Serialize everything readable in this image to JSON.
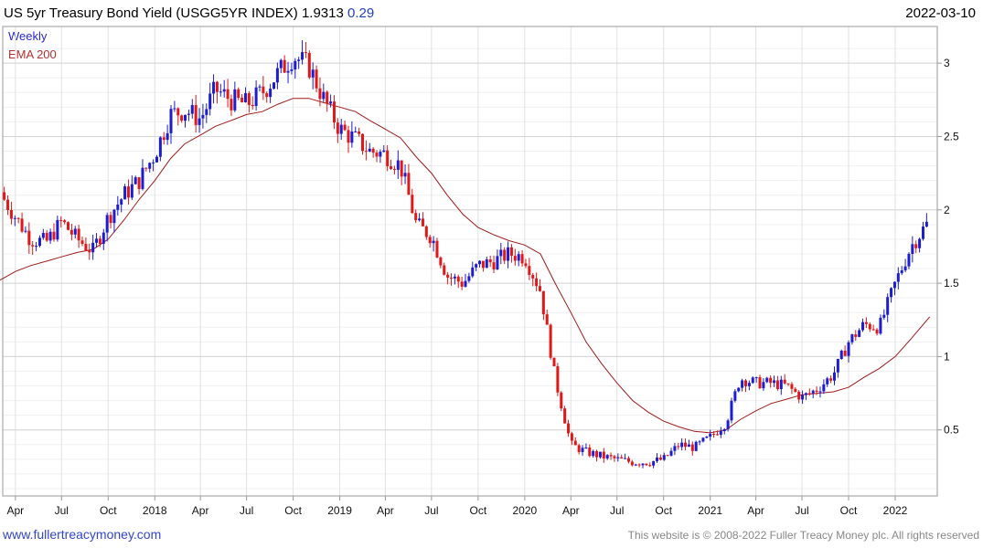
{
  "header": {
    "title": "US 5yr Treasury Bond Yield (USGG5YR INDEX) 1.9313",
    "change": "0.29",
    "date": "2022-03-10"
  },
  "legend": {
    "weekly": "Weekly",
    "ema": "EMA 200"
  },
  "footer": {
    "site": "www.fullertreacymoney.com",
    "copyright": "This website is © 2008-2022 Fuller Treacy Money plc. All rights reserved"
  },
  "colors": {
    "up": "#1c1cd0",
    "down": "#e01818",
    "ema": "#a01a1a",
    "grid": "#e2e2e2",
    "frame": "#999999"
  },
  "chart_data": {
    "type": "line",
    "title": "US 5yr Treasury Bond Yield (USGG5YR INDEX) 1.9313",
    "ylim": [
      0.05,
      3.25
    ],
    "y_ticks": [
      0.5,
      1,
      1.5,
      2,
      2.5,
      3
    ],
    "x_ticks": [
      {
        "label": "Apr",
        "x": "2017-04-01"
      },
      {
        "label": "Jul",
        "x": "2017-07-01"
      },
      {
        "label": "Oct",
        "x": "2017-10-01"
      },
      {
        "label": "2018",
        "x": "2018-01-01"
      },
      {
        "label": "Apr",
        "x": "2018-04-01"
      },
      {
        "label": "Jul",
        "x": "2018-07-01"
      },
      {
        "label": "Oct",
        "x": "2018-10-01"
      },
      {
        "label": "2019",
        "x": "2019-01-01"
      },
      {
        "label": "Apr",
        "x": "2019-04-01"
      },
      {
        "label": "Jul",
        "x": "2019-07-01"
      },
      {
        "label": "Oct",
        "x": "2019-10-01"
      },
      {
        "label": "2020",
        "x": "2020-01-01"
      },
      {
        "label": "Apr",
        "x": "2020-04-01"
      },
      {
        "label": "Jul",
        "x": "2020-07-01"
      },
      {
        "label": "Oct",
        "x": "2020-10-01"
      },
      {
        "label": "2021",
        "x": "2021-01-01"
      },
      {
        "label": "Apr",
        "x": "2021-04-01"
      },
      {
        "label": "Jul",
        "x": "2021-07-01"
      },
      {
        "label": "Oct",
        "x": "2021-10-01"
      },
      {
        "label": "2022",
        "x": "2022-01-01"
      }
    ],
    "series": [
      {
        "type": "line",
        "x": [
          "2017-03-01",
          "2017-04-01",
          "2017-05-01",
          "2017-06-01",
          "2017-07-01",
          "2017-08-01",
          "2017-09-01",
          "2017-10-01",
          "2017-11-01",
          "2017-12-01",
          "2018-01-01",
          "2018-02-01",
          "2018-03-01",
          "2018-04-01",
          "2018-05-01",
          "2018-06-01",
          "2018-07-01",
          "2018-08-01",
          "2018-09-01",
          "2018-10-01",
          "2018-11-01",
          "2018-12-01",
          "2019-01-01",
          "2019-02-01",
          "2019-03-01",
          "2019-04-01",
          "2019-05-01",
          "2019-06-01",
          "2019-07-01",
          "2019-08-01",
          "2019-09-01",
          "2019-10-01",
          "2019-11-01",
          "2019-12-01",
          "2020-01-01",
          "2020-02-01",
          "2020-03-01",
          "2020-04-01",
          "2020-05-01",
          "2020-06-01",
          "2020-07-01",
          "2020-08-01",
          "2020-09-01",
          "2020-10-01",
          "2020-11-01",
          "2020-12-01",
          "2021-01-01",
          "2021-02-01",
          "2021-03-01",
          "2021-04-01",
          "2021-05-01",
          "2021-06-01",
          "2021-07-01",
          "2021-08-01",
          "2021-09-01",
          "2021-10-01",
          "2021-11-01",
          "2021-12-01",
          "2022-01-01",
          "2022-02-01",
          "2022-03-10"
        ],
        "values": [
          1.52,
          1.58,
          1.62,
          1.65,
          1.68,
          1.71,
          1.73,
          1.8,
          1.93,
          2.07,
          2.2,
          2.35,
          2.45,
          2.51,
          2.57,
          2.61,
          2.65,
          2.67,
          2.72,
          2.76,
          2.76,
          2.73,
          2.7,
          2.67,
          2.61,
          2.55,
          2.49,
          2.36,
          2.25,
          2.1,
          1.97,
          1.88,
          1.83,
          1.79,
          1.76,
          1.7,
          1.5,
          1.3,
          1.1,
          0.95,
          0.82,
          0.7,
          0.62,
          0.56,
          0.52,
          0.49,
          0.48,
          0.5,
          0.57,
          0.63,
          0.68,
          0.71,
          0.74,
          0.75,
          0.76,
          0.79,
          0.86,
          0.92,
          1.0,
          1.12,
          1.27
        ]
      },
      {
        "type": "candlestick",
        "x": [
          "2017-03-01",
          "2017-04-01",
          "2017-05-01",
          "2017-06-01",
          "2017-07-01",
          "2017-08-01",
          "2017-09-01",
          "2017-10-01",
          "2017-11-01",
          "2017-12-01",
          "2018-01-01",
          "2018-02-01",
          "2018-03-01",
          "2018-04-01",
          "2018-05-01",
          "2018-06-01",
          "2018-07-01",
          "2018-08-01",
          "2018-09-01",
          "2018-10-01",
          "2018-11-01",
          "2018-12-01",
          "2019-01-01",
          "2019-02-01",
          "2019-03-01",
          "2019-04-01",
          "2019-05-01",
          "2019-06-01",
          "2019-07-01",
          "2019-08-01",
          "2019-09-01",
          "2019-10-01",
          "2019-11-01",
          "2019-12-01",
          "2020-01-01",
          "2020-02-01",
          "2020-03-01",
          "2020-04-01",
          "2020-05-01",
          "2020-06-01",
          "2020-07-01",
          "2020-08-01",
          "2020-09-01",
          "2020-10-01",
          "2020-11-01",
          "2020-12-01",
          "2021-01-01",
          "2021-02-01",
          "2021-03-01",
          "2021-04-01",
          "2021-05-01",
          "2021-06-01",
          "2021-07-01",
          "2021-08-01",
          "2021-09-01",
          "2021-10-01",
          "2021-11-01",
          "2021-12-01",
          "2022-01-01",
          "2022-02-01",
          "2022-03-10"
        ],
        "values": [
          2.12,
          1.95,
          1.8,
          1.78,
          1.92,
          1.8,
          1.72,
          1.95,
          2.1,
          2.2,
          2.38,
          2.65,
          2.68,
          2.62,
          2.82,
          2.75,
          2.72,
          2.8,
          2.93,
          3.05,
          2.98,
          2.75,
          2.55,
          2.48,
          2.4,
          2.38,
          2.3,
          1.9,
          1.82,
          1.55,
          1.5,
          1.62,
          1.65,
          1.7,
          1.68,
          1.45,
          0.85,
          0.4,
          0.35,
          0.32,
          0.3,
          0.28,
          0.28,
          0.3,
          0.4,
          0.38,
          0.45,
          0.55,
          0.85,
          0.82,
          0.82,
          0.8,
          0.72,
          0.78,
          0.88,
          1.1,
          1.22,
          1.2,
          1.5,
          1.75,
          1.93
        ]
      }
    ]
  }
}
